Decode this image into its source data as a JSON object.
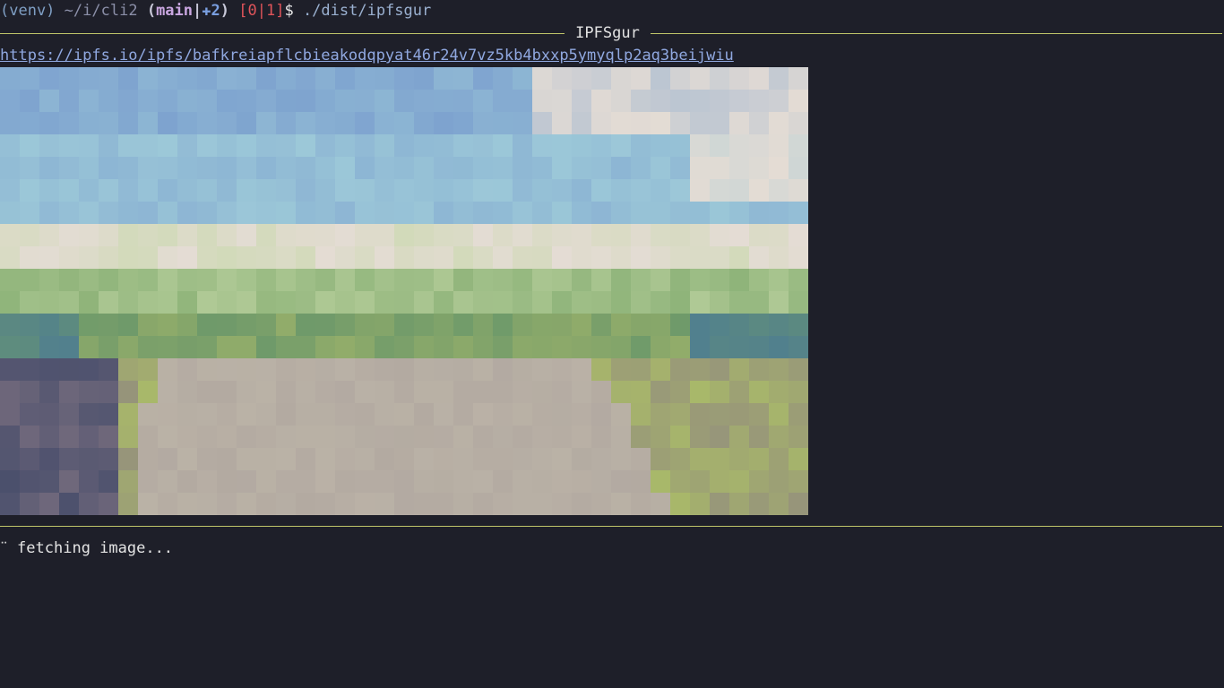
{
  "prompt": {
    "venv": "(venv)",
    "path": "~/i/cli2",
    "git_open": "(",
    "branch": "main",
    "git_sep": "|",
    "git_plus": "✚2",
    "git_close": ")",
    "status": "[0|1]",
    "dollar": "$",
    "command": "./dist/ipfsgur"
  },
  "app": {
    "title": "IPFSgur",
    "url": "https://ipfs.io/ipfs/bafkreiapflcbieakodqpyat46r24v7vz5kb4bxxp5ymyqlp2aq3beijwiu",
    "spinner": "⠉",
    "status": "fetching image..."
  },
  "colors": {
    "background": "#1e1f29",
    "rule": "#bfc469",
    "link": "#90a8e0"
  },
  "image": {
    "description_icon": "pixelated-landscape-image",
    "palette": {
      "sky_blue": "#7ea3cf",
      "sky_light": "#9cc8d8",
      "cloud": "#e4dcd4",
      "grass_light": "#c6d8a8",
      "grass": "#8fb47a",
      "grass_dark": "#6f9a6a",
      "teal": "#4f7e90",
      "road": "#bab2a6",
      "shadow": "#4a4f6c",
      "olive": "#a8b86a",
      "mauve": "#8a7a86"
    }
  }
}
